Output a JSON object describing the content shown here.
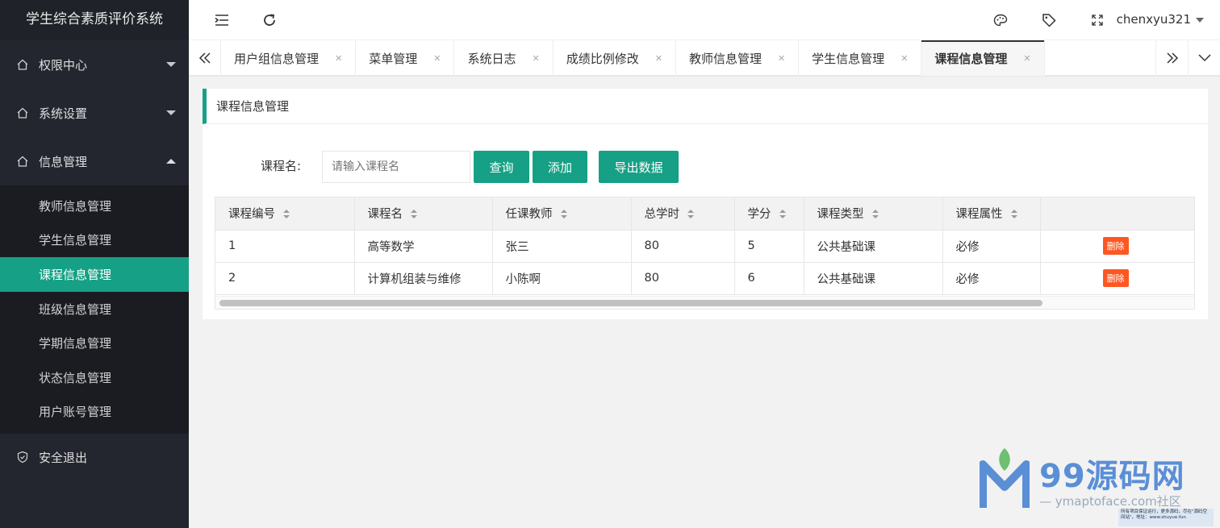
{
  "app": {
    "title": "学生综合素质评价系统"
  },
  "header": {
    "user": "chenxyu321"
  },
  "sidebar": {
    "groups": [
      {
        "label": "权限中心",
        "expanded": false
      },
      {
        "label": "系统设置",
        "expanded": false
      },
      {
        "label": "信息管理",
        "expanded": true
      }
    ],
    "sub_items": [
      {
        "label": "教师信息管理",
        "active": false
      },
      {
        "label": "学生信息管理",
        "active": false
      },
      {
        "label": "课程信息管理",
        "active": true
      },
      {
        "label": "班级信息管理",
        "active": false
      },
      {
        "label": "学期信息管理",
        "active": false
      },
      {
        "label": "状态信息管理",
        "active": false
      },
      {
        "label": "用户账号管理",
        "active": false
      }
    ],
    "logout": "安全退出"
  },
  "tabs": [
    {
      "label": "用户组信息管理",
      "active": false
    },
    {
      "label": "菜单管理",
      "active": false
    },
    {
      "label": "系统日志",
      "active": false
    },
    {
      "label": "成绩比例修改",
      "active": false
    },
    {
      "label": "教师信息管理",
      "active": false
    },
    {
      "label": "学生信息管理",
      "active": false
    },
    {
      "label": "课程信息管理",
      "active": true
    }
  ],
  "card": {
    "title": "课程信息管理",
    "search": {
      "label": "课程名:",
      "placeholder": "请输入课程名",
      "query_btn": "查询",
      "add_btn": "添加",
      "export_btn": "导出数据"
    }
  },
  "table": {
    "columns": [
      "课程编号",
      "课程名",
      "任课教师",
      "总学时",
      "学分",
      "课程类型",
      "课程属性",
      ""
    ],
    "rows": [
      [
        "1",
        "高等数学",
        "张三",
        "80",
        "5",
        "公共基础课",
        "必修"
      ],
      [
        "2",
        "计算机组装与维修",
        "小陈啊",
        "80",
        "6",
        "公共基础课",
        "必修"
      ]
    ],
    "delete_label": "删除"
  },
  "watermark": {
    "title": "99源码网",
    "subtitle": "— ymaptoface.com社区",
    "note": "所有项目保证运行，更多源码，尽在\"源码空间站\"，地址：www.shuyue.fun"
  },
  "colors": {
    "accent": "#16a085",
    "sidebar": "#23262e",
    "danger": "#ff5722"
  }
}
